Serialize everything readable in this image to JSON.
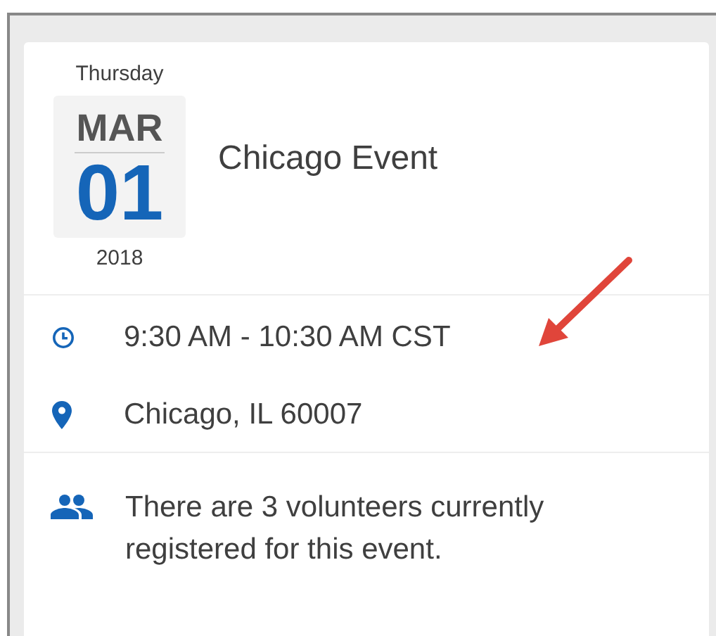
{
  "event": {
    "weekday": "Thursday",
    "month": "MAR",
    "day": "01",
    "year": "2018",
    "title": "Chicago Event"
  },
  "details": [
    {
      "kind": "time",
      "text": "9:30 AM - 10:30 AM CST"
    },
    {
      "kind": "location",
      "text": "Chicago, IL 60007"
    }
  ],
  "volunteers": {
    "kind": "volunteers",
    "text": "There are 3 volunteers currently registered for this event."
  }
}
